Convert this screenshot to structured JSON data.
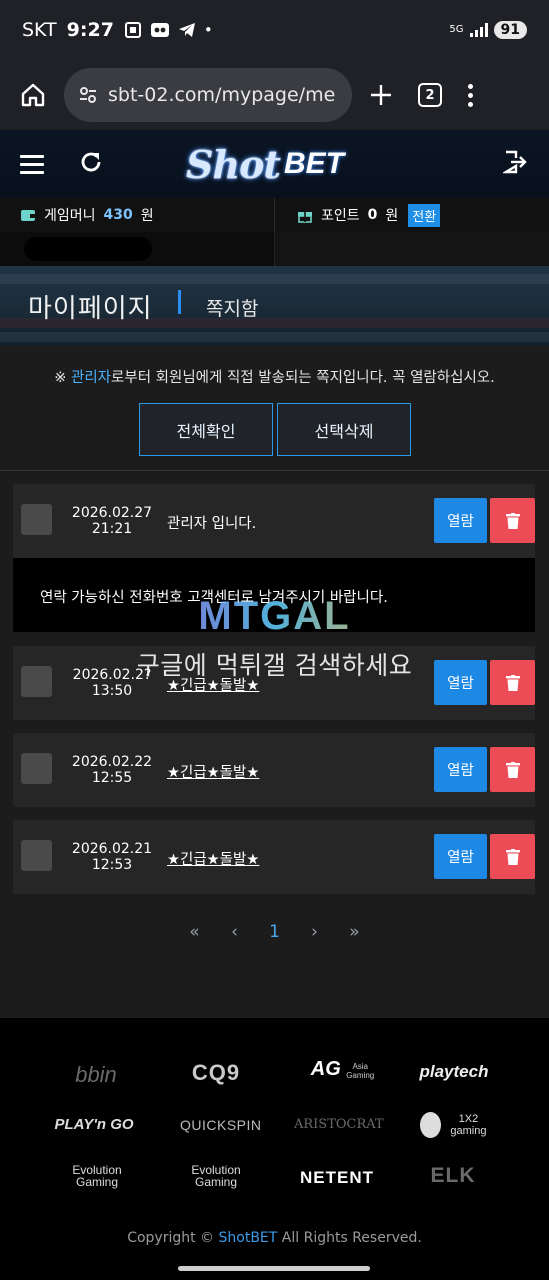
{
  "status_bar": {
    "carrier": "SKT",
    "time": "9:27",
    "network": "5G",
    "battery": "91",
    "dot": "•"
  },
  "browser": {
    "url": "sbt-02.com/mypage/me",
    "tab_count": "2"
  },
  "site": {
    "logo_part1": "Shot",
    "logo_part2": "BET"
  },
  "money": {
    "game_money_label": "게임머니",
    "game_money_value": "430",
    "game_money_unit": "원",
    "point_label": "포인트",
    "point_value": "0",
    "point_unit": "원",
    "convert_label": "전환"
  },
  "page": {
    "title": "마이페이지",
    "subtitle": "쪽지함"
  },
  "notice": {
    "prefix": "※ ",
    "admin": "관리자",
    "text": "로부터 회원님에게 직접 발송되는 쪽지입니다. 꼭 열람하십시오."
  },
  "actions": {
    "check_all": "전체확인",
    "delete_selected": "선택삭제"
  },
  "messages": [
    {
      "date": "2026.02.27",
      "time": "21:21",
      "title": "관리자 입니다.",
      "open_label": "열람"
    },
    {
      "date": "2026.02.2?",
      "time": "13:50",
      "title": "★긴급★돌발★",
      "open_label": "열람"
    },
    {
      "date": "2026.02.22",
      "time": "12:55",
      "title": "★긴급★돌발★",
      "open_label": "열람"
    },
    {
      "date": "2026.02.21",
      "time": "12:53",
      "title": "★긴급★돌발★",
      "open_label": "열람"
    }
  ],
  "message_body": "연락 가능하신 전화번호 고객센터로 남겨주시기 바랍니다.",
  "watermark": {
    "logo": "MTGAL",
    "text": "구글에 먹튀갤 검색하세요"
  },
  "pagination": {
    "first": "«",
    "prev": "‹",
    "current": "1",
    "next": "›",
    "last": "»"
  },
  "providers": {
    "bbin": "bbin",
    "cq9": "CQ9",
    "ag": "AG",
    "ag_sub": "Asia Gaming",
    "playtech": "playtech",
    "playngo": "PLAY'n GO",
    "quickspin": "QUICKSPIN",
    "aristocrat": "ARISTOCRAT",
    "onextwo": "1X2 gaming",
    "evolution1": "Evolution Gaming",
    "evolution2": "Evolution Gaming",
    "netent": "NETENT",
    "elk": "ELK"
  },
  "footer": {
    "copy_prefix": "Copyright ©",
    "brand": "ShotBET",
    "copy_suffix": "All Rights Reserved."
  }
}
